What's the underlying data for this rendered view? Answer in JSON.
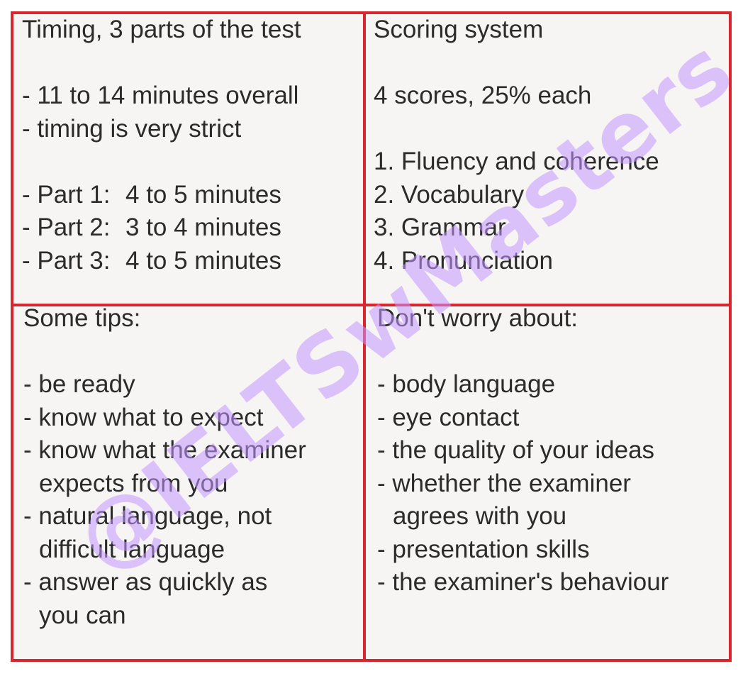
{
  "watermark": "@IELTSwMasters",
  "colors": {
    "border": "#d8262f",
    "background": "#f6f5f4",
    "text": "#2b2b2b",
    "watermark": "#c496ff"
  },
  "timing": {
    "title": "Timing, 3 parts of the test",
    "lines": [
      "- 11 to 14 minutes overall",
      "- timing is very strict"
    ],
    "parts": [
      {
        "label": "- Part 1:",
        "value": "4 to 5 minutes"
      },
      {
        "label": "- Part 2:",
        "value": "3 to 4 minutes"
      },
      {
        "label": "- Part 3:",
        "value": "4 to 5 minutes"
      }
    ]
  },
  "scoring": {
    "title": "Scoring system",
    "summary": "4 scores, 25% each",
    "items": [
      "1. Fluency and coherence",
      "2. Vocabulary",
      "3. Grammar",
      "4. Pronunciation"
    ]
  },
  "tips": {
    "title": "Some tips:",
    "items": [
      "- be ready",
      "- know what to expect",
      "- know what the examiner",
      "expects from you",
      "- natural language, not",
      "difficult language",
      "- answer as quickly as",
      "you can"
    ]
  },
  "dont_worry": {
    "title": "Don't worry about:",
    "items": [
      "- body language",
      "- eye contact",
      "- the quality of your ideas",
      "- whether the examiner",
      "agrees with you",
      "- presentation skills",
      "- the examiner's behaviour"
    ]
  }
}
